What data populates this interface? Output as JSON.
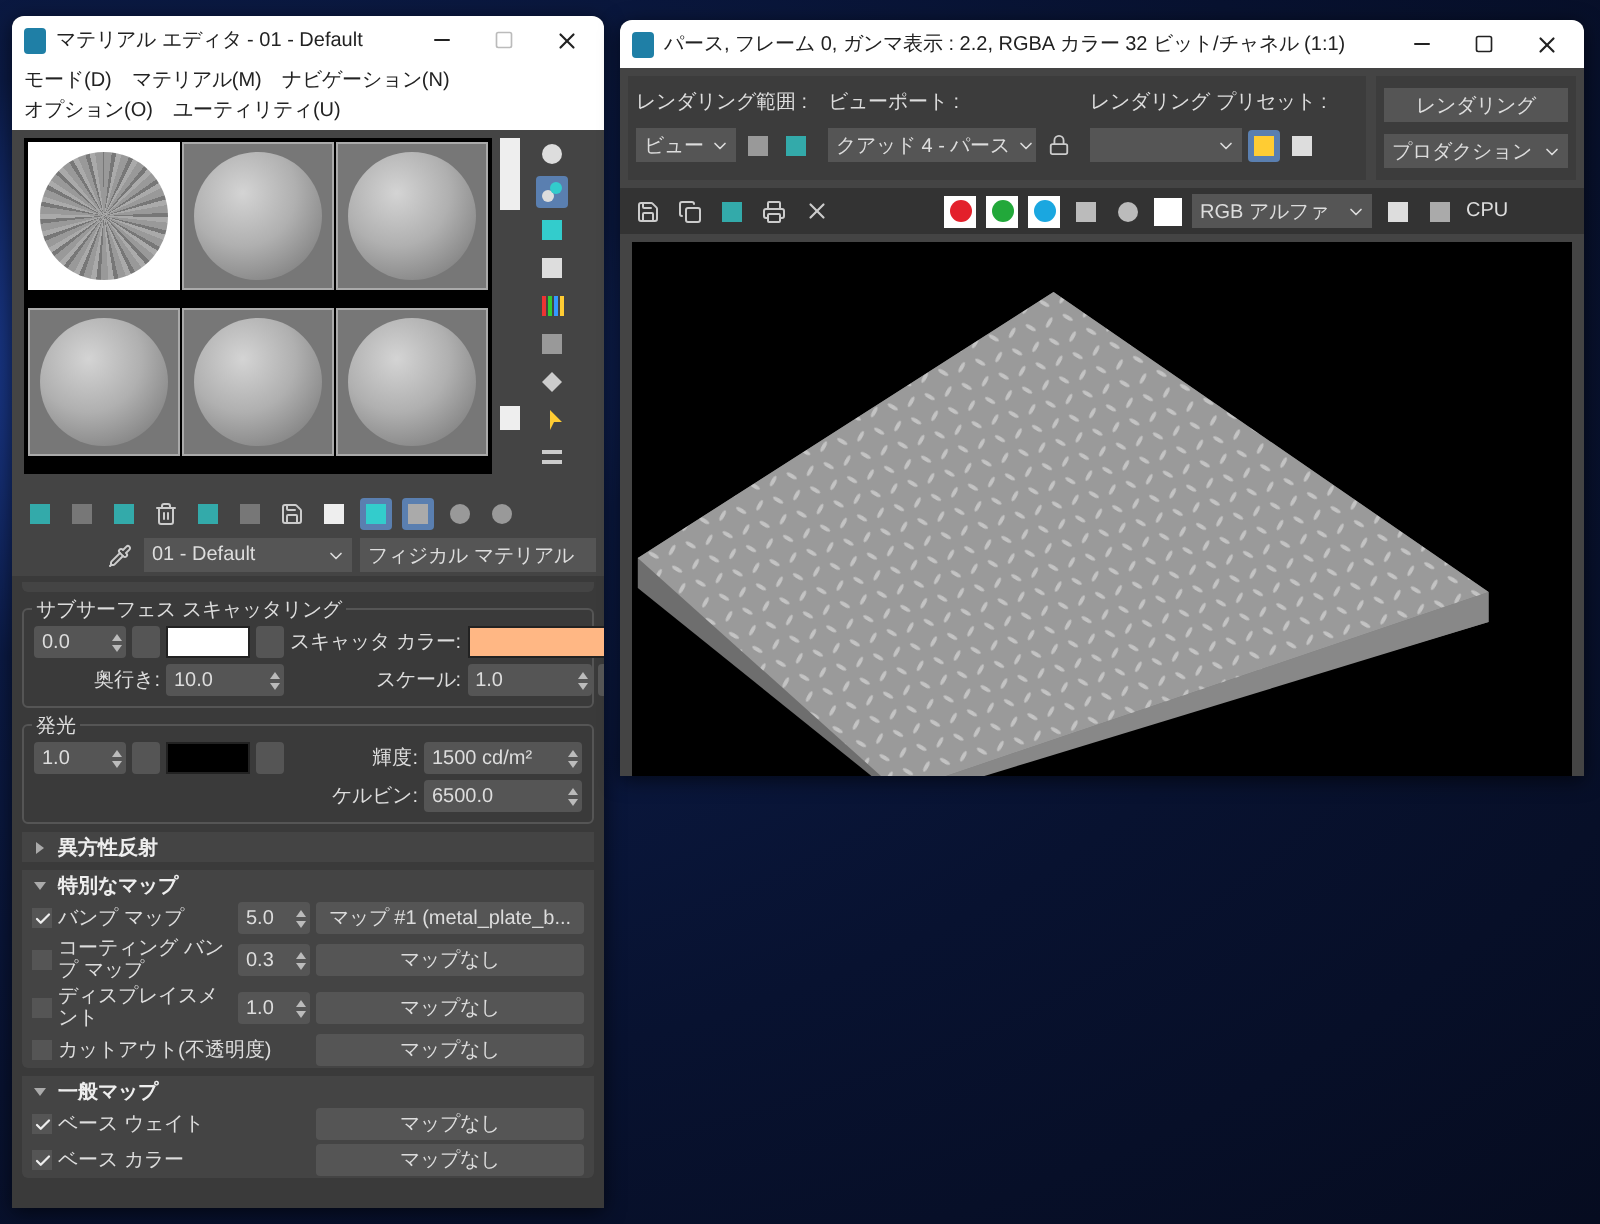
{
  "material_editor": {
    "title": "マテリアル エディタ - 01 - Default",
    "menu": [
      "モード(D)",
      "マテリアル(M)",
      "ナビゲーション(N)",
      "オプション(O)",
      "ユーティリティ(U)"
    ],
    "slots": [
      {
        "kind": "textured",
        "selected": true
      },
      {
        "kind": "plain",
        "selected": false
      },
      {
        "kind": "plain",
        "selected": false
      },
      {
        "kind": "plain",
        "selected": false
      },
      {
        "kind": "plain",
        "selected": false
      },
      {
        "kind": "plain",
        "selected": false
      }
    ],
    "material_name": "01 - Default",
    "material_type": "フィジカル マテリアル",
    "subsurface": {
      "title": "サブサーフェス スキャッタリング",
      "amount": "0.0",
      "swatch": {
        "color": "#ffffff"
      },
      "scatter_color_label": "スキャッタ カラー:",
      "scatter_swatch": {
        "color": "#ffb784"
      },
      "depth_label": "奥行き:",
      "depth": "10.0",
      "scale_label": "スケール:",
      "scale": "1.0"
    },
    "emission": {
      "title": "発光",
      "amount": "1.0",
      "swatch": {
        "color": "#000000"
      },
      "luminance_label": "輝度:",
      "luminance": "1500 cd/m²",
      "kelvin_label": "ケルビン:",
      "kelvin": "6500.0"
    },
    "rollouts": [
      {
        "title": "異方性反射",
        "expanded": false
      },
      {
        "title": "特別なマップ",
        "expanded": true,
        "rows": [
          {
            "label": "バンプ マップ",
            "checked": true,
            "amount": "5.0",
            "map": "マップ #1 (metal_plate_b..."
          },
          {
            "label": "コーティング バンプ マップ",
            "checked": false,
            "amount": "0.3",
            "map": "マップなし"
          },
          {
            "label": "ディスプレイスメント",
            "checked": false,
            "amount": "1.0",
            "map": "マップなし"
          },
          {
            "label": "カットアウト(不透明度)",
            "checked": false,
            "map": "マップなし"
          }
        ]
      },
      {
        "title": "一般マップ",
        "expanded": true,
        "rows": [
          {
            "label": "ベース ウェイト",
            "checked": true,
            "map": "マップなし"
          },
          {
            "label": "ベース カラー",
            "checked": true,
            "map": "マップなし"
          }
        ]
      }
    ]
  },
  "render_window": {
    "title": "パース, フレーム 0, ガンマ表示 : 2.2, RGBA カラー 32 ビット/チャネル (1:1)",
    "area_label": "レンダリング範囲 :",
    "area": "ビュー",
    "viewport_label": "ビューポート :",
    "viewport": "クアッド 4 - パース",
    "preset_label": "レンダリング プリセット :",
    "render_button": "レンダリング",
    "render_mode": "プロダクション",
    "channels": [
      {
        "color": "#e3202b",
        "selected": true
      },
      {
        "color": "#22a83a",
        "selected": true
      },
      {
        "color": "#1aa7e0",
        "selected": true
      }
    ],
    "display_channel": "RGB アルファ",
    "engine": "CPU"
  }
}
